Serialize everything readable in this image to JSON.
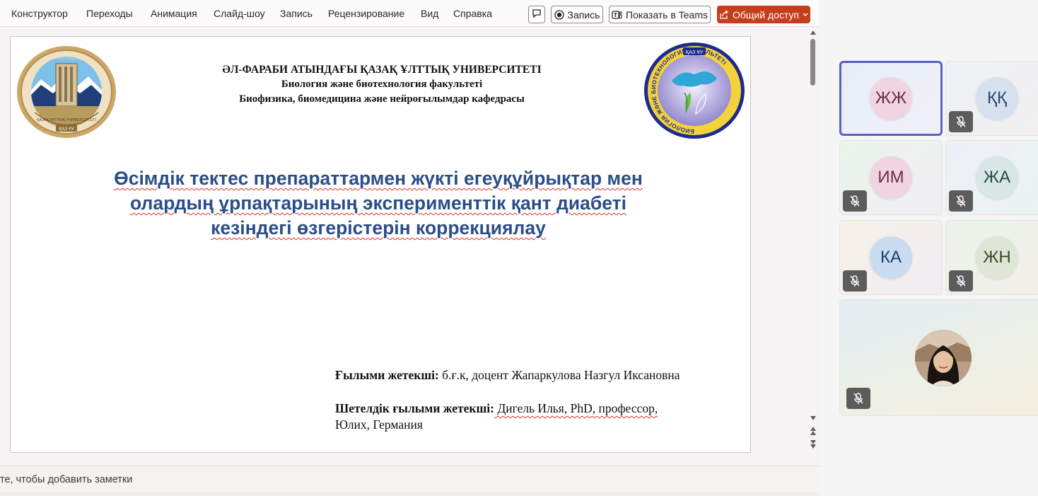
{
  "ribbon": {
    "tabs": [
      "Конструктор",
      "Переходы",
      "Анимация",
      "Слайд-шоу",
      "Запись",
      "Рецензирование",
      "Вид",
      "Справка"
    ],
    "record_label": "Запись",
    "teams_label": "Показать в Teams",
    "share_label": "Общий доступ",
    "share_color": "#c43e1c"
  },
  "slide": {
    "header_line1": "ӘЛ-ФАРАБИ АТЫНДАҒЫ ҚАЗАҚ ҰЛТТЫҚ УНИВЕРСИТЕТІ",
    "header_line2": "Биология және биотехнология факультеті",
    "header_line3": "Биофизика, биомедицина және нейроғылымдар кафедрасы",
    "logo_left_text": "ҚАЗАҚ ҰЛТТЫҚ УНИВЕРСИТЕТІ",
    "logo_left_badge": "ҚАЗ ҰУ",
    "logo_right_text": "БИОЛОГИЯ ЖӘНЕ БИОТЕХНОЛОГИЯ ФАКУЛЬТЕТІ",
    "logo_right_badge": "ҚАЗ ҰУ",
    "title_line1": "Өсімдік тектес препараттармен жүкті егеуқұйрықтар мен",
    "title_line2": "олардың ұрпақтарының эксперименттік қант диабеті",
    "title_line3": "кезіндегі өзгерістерін коррекциялау",
    "title_color": "#2b4e88",
    "supervisor_label": "Ғылыми жетекші:",
    "supervisor_value": " б.ғ.к, доцент Жапаркулова Назгул Иксановна",
    "foreign_label": "Шетелдік ғылыми жетекші:",
    "foreign_value": " Дигель Илья, PhD, профессор,",
    "foreign_value2": "Юлих, Германия"
  },
  "notes": {
    "placeholder": "те, чтобы добавить заметки"
  },
  "meeting": {
    "accent": "#5b5fc7",
    "participants": [
      {
        "initials": "ЖЖ",
        "muted": false,
        "active": true
      },
      {
        "initials": "ҚҚ",
        "muted": true,
        "active": false
      },
      {
        "initials": "ИМ",
        "muted": true,
        "active": false
      },
      {
        "initials": "ЖА",
        "muted": true,
        "active": false
      },
      {
        "initials": "КА",
        "muted": true,
        "active": false
      },
      {
        "initials": "ЖН",
        "muted": true,
        "active": false
      },
      {
        "initials": "",
        "muted": true,
        "active": false,
        "video_photo": true
      }
    ]
  }
}
